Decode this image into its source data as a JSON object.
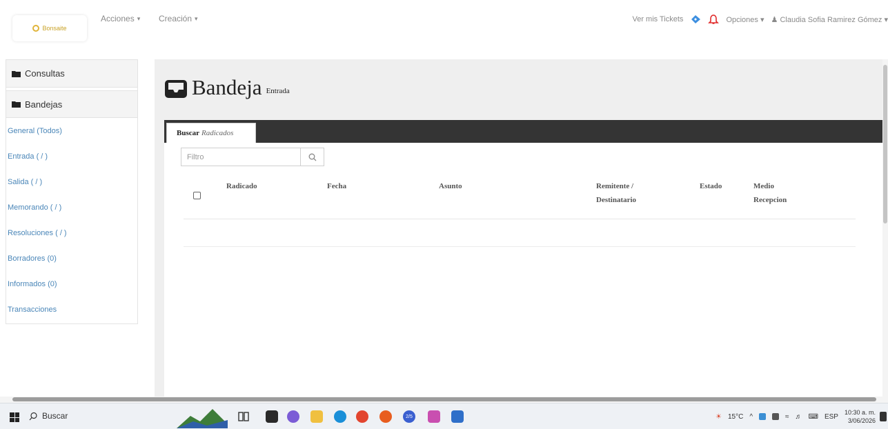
{
  "navbar": {
    "logo_text": "Bonsaite",
    "menu_acciones": "Acciones",
    "menu_creacion": "Creación",
    "tickets_link": "Ver mis Tickets",
    "opciones": "Opciones",
    "user_name": "Claudia Sofia Ramirez Gómez",
    "colors": {
      "ticket": "#3d8fe0",
      "bell": "#e02a2a"
    }
  },
  "sidebar": {
    "headers": [
      "Consultas",
      "Bandejas"
    ],
    "items": [
      {
        "label": "General (Todos)"
      },
      {
        "label": "Entrada ( / )"
      },
      {
        "label": "Salida ( / )"
      },
      {
        "label": "Memorando ( / )"
      },
      {
        "label": "Resoluciones ( / )"
      },
      {
        "label": "Borradores (0)"
      },
      {
        "label": "Informados (0)"
      },
      {
        "label": "Transacciones"
      }
    ],
    "link_color": "#4a86b8"
  },
  "main": {
    "title": "Bandeja",
    "subtitle": "Entrada",
    "tab": {
      "bold": "Buscar",
      "italic": "Radicados"
    },
    "filter_placeholder": "Filtro",
    "columns": [
      {
        "line1": "Radicado",
        "line2": ""
      },
      {
        "line1": "Fecha",
        "line2": ""
      },
      {
        "line1": "Asunto",
        "line2": ""
      },
      {
        "line1": "Remitente /",
        "line2": "Destinatario"
      },
      {
        "line1": "Estado",
        "line2": ""
      },
      {
        "line1": "Medio",
        "line2": "Recepcion"
      }
    ]
  },
  "taskbar": {
    "search_label": "Buscar",
    "weather": "15°C",
    "language": "ESP",
    "time": "10:30 a. m.",
    "date": "3/06/2026",
    "badge": "2/5"
  }
}
